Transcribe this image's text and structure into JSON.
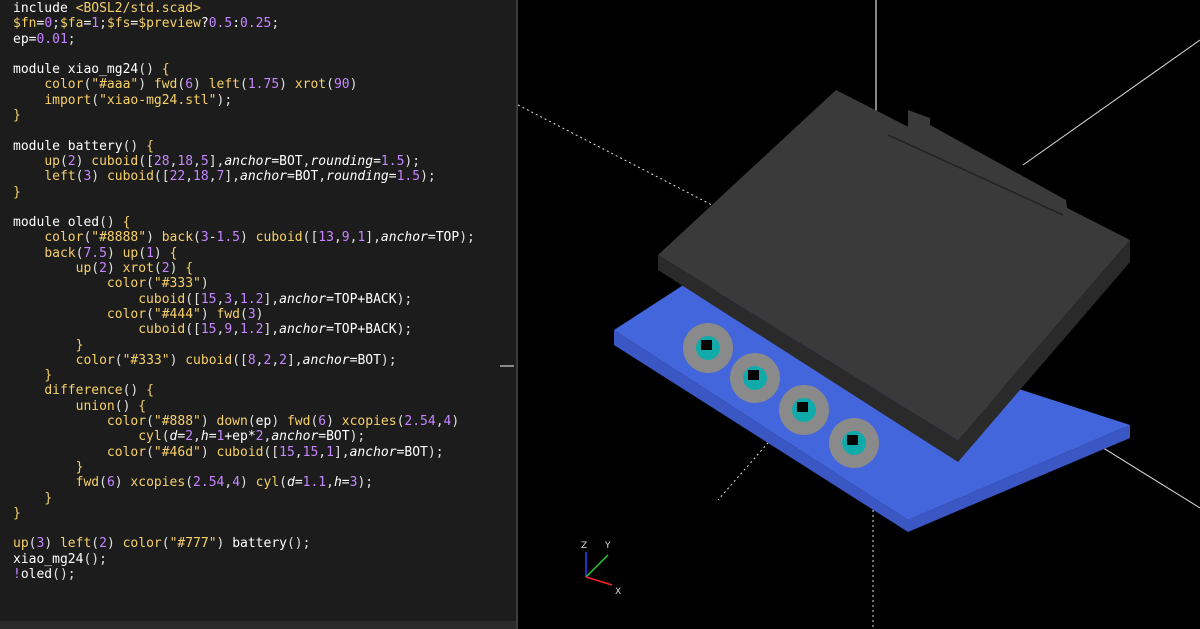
{
  "editor": {
    "lines": [
      [
        [
          "t-key",
          "include "
        ],
        [
          "t-str",
          "<BOSL2/std.scad>"
        ]
      ],
      [
        [
          "t-var",
          "$fn"
        ],
        [
          "t-op",
          "="
        ],
        [
          "t-num",
          "0"
        ],
        [
          "t-punc",
          ";"
        ],
        [
          "t-var",
          "$fa"
        ],
        [
          "t-op",
          "="
        ],
        [
          "t-num",
          "1"
        ],
        [
          "t-punc",
          ";"
        ],
        [
          "t-var",
          "$fs"
        ],
        [
          "t-op",
          "="
        ],
        [
          "t-var",
          "$preview"
        ],
        [
          "t-op",
          "?"
        ],
        [
          "t-num",
          "0.5"
        ],
        [
          "t-op",
          ":"
        ],
        [
          "t-num",
          "0.25"
        ],
        [
          "t-punc",
          ";"
        ]
      ],
      [
        [
          "t-id",
          "ep"
        ],
        [
          "t-op",
          "="
        ],
        [
          "t-num",
          "0.01"
        ],
        [
          "t-punc",
          ";"
        ]
      ],
      [],
      [
        [
          "t-key",
          "module "
        ],
        [
          "t-id",
          "xiao_mg24"
        ],
        [
          "t-punc",
          "() "
        ],
        [
          "t-brace",
          "{"
        ]
      ],
      [
        [
          "t-id",
          "    "
        ],
        [
          "t-fn",
          "color"
        ],
        [
          "t-punc",
          "("
        ],
        [
          "t-str",
          "\"#aaa\""
        ],
        [
          "t-punc",
          ") "
        ],
        [
          "t-fn",
          "fwd"
        ],
        [
          "t-punc",
          "("
        ],
        [
          "t-num",
          "6"
        ],
        [
          "t-punc",
          ") "
        ],
        [
          "t-fn",
          "left"
        ],
        [
          "t-punc",
          "("
        ],
        [
          "t-num",
          "1.75"
        ],
        [
          "t-punc",
          ") "
        ],
        [
          "t-fn",
          "xrot"
        ],
        [
          "t-punc",
          "("
        ],
        [
          "t-num",
          "90"
        ],
        [
          "t-punc",
          ")"
        ]
      ],
      [
        [
          "t-id",
          "    "
        ],
        [
          "t-fn",
          "import"
        ],
        [
          "t-punc",
          "("
        ],
        [
          "t-str",
          "\"xiao-mg24.stl\""
        ],
        [
          "t-punc",
          ");"
        ]
      ],
      [
        [
          "t-brace",
          "}"
        ]
      ],
      [],
      [
        [
          "t-key",
          "module "
        ],
        [
          "t-id",
          "battery"
        ],
        [
          "t-punc",
          "() "
        ],
        [
          "t-brace",
          "{"
        ]
      ],
      [
        [
          "t-id",
          "    "
        ],
        [
          "t-fn",
          "up"
        ],
        [
          "t-punc",
          "("
        ],
        [
          "t-num",
          "2"
        ],
        [
          "t-punc",
          ") "
        ],
        [
          "t-fn",
          "cuboid"
        ],
        [
          "t-punc",
          "(["
        ],
        [
          "t-num",
          "28"
        ],
        [
          "t-punc",
          ","
        ],
        [
          "t-num",
          "18"
        ],
        [
          "t-punc",
          ","
        ],
        [
          "t-num",
          "5"
        ],
        [
          "t-punc",
          "],"
        ],
        [
          "t-arg",
          "anchor"
        ],
        [
          "t-op",
          "="
        ],
        [
          "t-id",
          "BOT"
        ],
        [
          "t-punc",
          ","
        ],
        [
          "t-arg",
          "rounding"
        ],
        [
          "t-op",
          "="
        ],
        [
          "t-num",
          "1.5"
        ],
        [
          "t-punc",
          ");"
        ]
      ],
      [
        [
          "t-id",
          "    "
        ],
        [
          "t-fn",
          "left"
        ],
        [
          "t-punc",
          "("
        ],
        [
          "t-num",
          "3"
        ],
        [
          "t-punc",
          ") "
        ],
        [
          "t-fn",
          "cuboid"
        ],
        [
          "t-punc",
          "(["
        ],
        [
          "t-num",
          "22"
        ],
        [
          "t-punc",
          ","
        ],
        [
          "t-num",
          "18"
        ],
        [
          "t-punc",
          ","
        ],
        [
          "t-num",
          "7"
        ],
        [
          "t-punc",
          "],"
        ],
        [
          "t-arg",
          "anchor"
        ],
        [
          "t-op",
          "="
        ],
        [
          "t-id",
          "BOT"
        ],
        [
          "t-punc",
          ","
        ],
        [
          "t-arg",
          "rounding"
        ],
        [
          "t-op",
          "="
        ],
        [
          "t-num",
          "1.5"
        ],
        [
          "t-punc",
          ");"
        ]
      ],
      [
        [
          "t-brace",
          "}"
        ]
      ],
      [],
      [
        [
          "t-key",
          "module "
        ],
        [
          "t-id",
          "oled"
        ],
        [
          "t-punc",
          "() "
        ],
        [
          "t-brace",
          "{"
        ]
      ],
      [
        [
          "t-id",
          "    "
        ],
        [
          "t-fn",
          "color"
        ],
        [
          "t-punc",
          "("
        ],
        [
          "t-str",
          "\"#8888\""
        ],
        [
          "t-punc",
          ") "
        ],
        [
          "t-fn",
          "back"
        ],
        [
          "t-punc",
          "("
        ],
        [
          "t-num",
          "3"
        ],
        [
          "t-op",
          "-"
        ],
        [
          "t-num",
          "1.5"
        ],
        [
          "t-punc",
          ") "
        ],
        [
          "t-fn",
          "cuboid"
        ],
        [
          "t-punc",
          "(["
        ],
        [
          "t-num",
          "13"
        ],
        [
          "t-punc",
          ","
        ],
        [
          "t-num",
          "9"
        ],
        [
          "t-punc",
          ","
        ],
        [
          "t-num",
          "1"
        ],
        [
          "t-punc",
          "],"
        ],
        [
          "t-arg",
          "anchor"
        ],
        [
          "t-op",
          "="
        ],
        [
          "t-id",
          "TOP"
        ],
        [
          "t-punc",
          ");"
        ]
      ],
      [
        [
          "t-id",
          "    "
        ],
        [
          "t-fn",
          "back"
        ],
        [
          "t-punc",
          "("
        ],
        [
          "t-num",
          "7.5"
        ],
        [
          "t-punc",
          ") "
        ],
        [
          "t-fn",
          "up"
        ],
        [
          "t-punc",
          "("
        ],
        [
          "t-num",
          "1"
        ],
        [
          "t-punc",
          ") "
        ],
        [
          "t-brace",
          "{"
        ]
      ],
      [
        [
          "t-id",
          "        "
        ],
        [
          "t-fn",
          "up"
        ],
        [
          "t-punc",
          "("
        ],
        [
          "t-num",
          "2"
        ],
        [
          "t-punc",
          ") "
        ],
        [
          "t-fn",
          "xrot"
        ],
        [
          "t-punc",
          "("
        ],
        [
          "t-num",
          "2"
        ],
        [
          "t-punc",
          ") "
        ],
        [
          "t-brace",
          "{"
        ]
      ],
      [
        [
          "t-id",
          "            "
        ],
        [
          "t-fn",
          "color"
        ],
        [
          "t-punc",
          "("
        ],
        [
          "t-str",
          "\"#333\""
        ],
        [
          "t-punc",
          ")"
        ]
      ],
      [
        [
          "t-id",
          "                "
        ],
        [
          "t-fn",
          "cuboid"
        ],
        [
          "t-punc",
          "(["
        ],
        [
          "t-num",
          "15"
        ],
        [
          "t-punc",
          ","
        ],
        [
          "t-num",
          "3"
        ],
        [
          "t-punc",
          ","
        ],
        [
          "t-num",
          "1.2"
        ],
        [
          "t-punc",
          "],"
        ],
        [
          "t-arg",
          "anchor"
        ],
        [
          "t-op",
          "="
        ],
        [
          "t-id",
          "TOP+BACK"
        ],
        [
          "t-punc",
          ");"
        ]
      ],
      [
        [
          "t-id",
          "            "
        ],
        [
          "t-fn",
          "color"
        ],
        [
          "t-punc",
          "("
        ],
        [
          "t-str",
          "\"#444\""
        ],
        [
          "t-punc",
          ") "
        ],
        [
          "t-fn",
          "fwd"
        ],
        [
          "t-punc",
          "("
        ],
        [
          "t-num",
          "3"
        ],
        [
          "t-punc",
          ")"
        ]
      ],
      [
        [
          "t-id",
          "                "
        ],
        [
          "t-fn",
          "cuboid"
        ],
        [
          "t-punc",
          "(["
        ],
        [
          "t-num",
          "15"
        ],
        [
          "t-punc",
          ","
        ],
        [
          "t-num",
          "9"
        ],
        [
          "t-punc",
          ","
        ],
        [
          "t-num",
          "1.2"
        ],
        [
          "t-punc",
          "],"
        ],
        [
          "t-arg",
          "anchor"
        ],
        [
          "t-op",
          "="
        ],
        [
          "t-id",
          "TOP+BACK"
        ],
        [
          "t-punc",
          ");"
        ]
      ],
      [
        [
          "t-id",
          "        "
        ],
        [
          "t-brace",
          "}"
        ]
      ],
      [
        [
          "t-id",
          "        "
        ],
        [
          "t-fn",
          "color"
        ],
        [
          "t-punc",
          "("
        ],
        [
          "t-str",
          "\"#333\""
        ],
        [
          "t-punc",
          ") "
        ],
        [
          "t-fn",
          "cuboid"
        ],
        [
          "t-punc",
          "(["
        ],
        [
          "t-num",
          "8"
        ],
        [
          "t-punc",
          ","
        ],
        [
          "t-num",
          "2"
        ],
        [
          "t-punc",
          ","
        ],
        [
          "t-num",
          "2"
        ],
        [
          "t-punc",
          "],"
        ],
        [
          "t-arg",
          "anchor"
        ],
        [
          "t-op",
          "="
        ],
        [
          "t-id",
          "BOT"
        ],
        [
          "t-punc",
          ");"
        ]
      ],
      [
        [
          "t-id",
          "    "
        ],
        [
          "t-brace",
          "}"
        ]
      ],
      [
        [
          "t-id",
          "    "
        ],
        [
          "t-fn",
          "difference"
        ],
        [
          "t-punc",
          "() "
        ],
        [
          "t-brace",
          "{"
        ]
      ],
      [
        [
          "t-id",
          "        "
        ],
        [
          "t-fn",
          "union"
        ],
        [
          "t-punc",
          "() "
        ],
        [
          "t-brace",
          "{"
        ]
      ],
      [
        [
          "t-id",
          "            "
        ],
        [
          "t-fn",
          "color"
        ],
        [
          "t-punc",
          "("
        ],
        [
          "t-str",
          "\"#888\""
        ],
        [
          "t-punc",
          ") "
        ],
        [
          "t-fn",
          "down"
        ],
        [
          "t-punc",
          "("
        ],
        [
          "t-id",
          "ep"
        ],
        [
          "t-punc",
          ") "
        ],
        [
          "t-fn",
          "fwd"
        ],
        [
          "t-punc",
          "("
        ],
        [
          "t-num",
          "6"
        ],
        [
          "t-punc",
          ") "
        ],
        [
          "t-fn",
          "xcopies"
        ],
        [
          "t-punc",
          "("
        ],
        [
          "t-num",
          "2.54"
        ],
        [
          "t-punc",
          ","
        ],
        [
          "t-num",
          "4"
        ],
        [
          "t-punc",
          ")"
        ]
      ],
      [
        [
          "t-id",
          "                "
        ],
        [
          "t-fn",
          "cyl"
        ],
        [
          "t-punc",
          "("
        ],
        [
          "t-arg",
          "d"
        ],
        [
          "t-op",
          "="
        ],
        [
          "t-num",
          "2"
        ],
        [
          "t-punc",
          ","
        ],
        [
          "t-arg",
          "h"
        ],
        [
          "t-op",
          "="
        ],
        [
          "t-num",
          "1"
        ],
        [
          "t-op",
          "+"
        ],
        [
          "t-id",
          "ep"
        ],
        [
          "t-op",
          "*"
        ],
        [
          "t-num",
          "2"
        ],
        [
          "t-punc",
          ","
        ],
        [
          "t-arg",
          "anchor"
        ],
        [
          "t-op",
          "="
        ],
        [
          "t-id",
          "BOT"
        ],
        [
          "t-punc",
          ");"
        ]
      ],
      [
        [
          "t-id",
          "            "
        ],
        [
          "t-fn",
          "color"
        ],
        [
          "t-punc",
          "("
        ],
        [
          "t-str",
          "\"#46d\""
        ],
        [
          "t-punc",
          ") "
        ],
        [
          "t-fn",
          "cuboid"
        ],
        [
          "t-punc",
          "(["
        ],
        [
          "t-num",
          "15"
        ],
        [
          "t-punc",
          ","
        ],
        [
          "t-num",
          "15"
        ],
        [
          "t-punc",
          ","
        ],
        [
          "t-num",
          "1"
        ],
        [
          "t-punc",
          "],"
        ],
        [
          "t-arg",
          "anchor"
        ],
        [
          "t-op",
          "="
        ],
        [
          "t-id",
          "BOT"
        ],
        [
          "t-punc",
          ");"
        ]
      ],
      [
        [
          "t-id",
          "        "
        ],
        [
          "t-brace",
          "}"
        ]
      ],
      [
        [
          "t-id",
          "        "
        ],
        [
          "t-fn",
          "fwd"
        ],
        [
          "t-punc",
          "("
        ],
        [
          "t-num",
          "6"
        ],
        [
          "t-punc",
          ") "
        ],
        [
          "t-fn",
          "xcopies"
        ],
        [
          "t-punc",
          "("
        ],
        [
          "t-num",
          "2.54"
        ],
        [
          "t-punc",
          ","
        ],
        [
          "t-num",
          "4"
        ],
        [
          "t-punc",
          ") "
        ],
        [
          "t-fn",
          "cyl"
        ],
        [
          "t-punc",
          "("
        ],
        [
          "t-arg",
          "d"
        ],
        [
          "t-op",
          "="
        ],
        [
          "t-num",
          "1.1"
        ],
        [
          "t-punc",
          ","
        ],
        [
          "t-arg",
          "h"
        ],
        [
          "t-op",
          "="
        ],
        [
          "t-num",
          "3"
        ],
        [
          "t-punc",
          ");"
        ]
      ],
      [
        [
          "t-id",
          "    "
        ],
        [
          "t-brace",
          "}"
        ]
      ],
      [
        [
          "t-brace",
          "}"
        ]
      ],
      [],
      [
        [
          "t-fn",
          "up"
        ],
        [
          "t-punc",
          "("
        ],
        [
          "t-num",
          "3"
        ],
        [
          "t-punc",
          ") "
        ],
        [
          "t-fn",
          "left"
        ],
        [
          "t-punc",
          "("
        ],
        [
          "t-num",
          "2"
        ],
        [
          "t-punc",
          ") "
        ],
        [
          "t-fn",
          "color"
        ],
        [
          "t-punc",
          "("
        ],
        [
          "t-str",
          "\"#777\""
        ],
        [
          "t-punc",
          ") "
        ],
        [
          "t-id",
          "battery"
        ],
        [
          "t-punc",
          "();"
        ]
      ],
      [
        [
          "t-id",
          "xiao_mg24"
        ],
        [
          "t-punc",
          "();"
        ]
      ],
      [
        [
          "t-mod",
          "!"
        ],
        [
          "t-id",
          "oled"
        ],
        [
          "t-punc",
          "();"
        ]
      ]
    ]
  },
  "viewport": {
    "colors": {
      "background": "#000000",
      "board": "#4466dd",
      "board_side": "#3a57c4",
      "battery_top": "#3a3a3a",
      "battery_side": "#2a2a2a",
      "pin_ring": "#8a8a8a",
      "pin_hole": "#11aaaa"
    },
    "axes": {
      "z": "Z",
      "y": "Y",
      "x": "X"
    }
  }
}
